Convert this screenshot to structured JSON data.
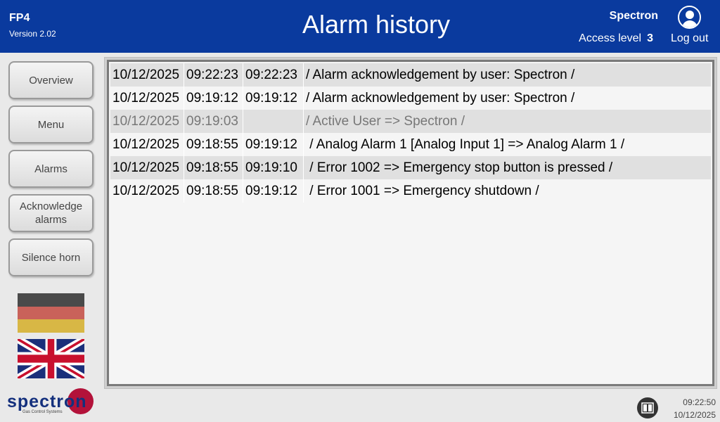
{
  "header": {
    "app_name": "FP4",
    "version": "Version 2.02",
    "title": "Alarm history",
    "user_name": "Spectron",
    "access_label": "Access level",
    "access_level": "3",
    "logout_label": "Log out"
  },
  "sidebar": {
    "overview": "Overview",
    "menu": "Menu",
    "alarms": "Alarms",
    "acknowledge": "Acknowledge alarms",
    "silence": "Silence horn"
  },
  "languages": [
    "German",
    "English"
  ],
  "logo": {
    "brand": "spectron",
    "tagline": "Gas Control Systems"
  },
  "alarm_history": [
    {
      "date": "10/12/2025",
      "time1": "09:22:23",
      "time2": "09:22:23",
      "message": "/ Alarm acknowledgement by user: Spectron /"
    },
    {
      "date": "10/12/2025",
      "time1": "09:19:12",
      "time2": "09:19:12",
      "message": "/ Alarm acknowledgement by user: Spectron /"
    },
    {
      "date": "10/12/2025",
      "time1": "09:19:03",
      "time2": "",
      "message": "/ Active User => Spectron /"
    },
    {
      "date": "10/12/2025",
      "time1": "09:18:55",
      "time2": "09:19:12",
      "message": " / Analog Alarm 1 [Analog Input 1] => Analog Alarm 1 /"
    },
    {
      "date": "10/12/2025",
      "time1": "09:18:55",
      "time2": "09:19:10",
      "message": " / Error 1002 => Emergency stop button is pressed /"
    },
    {
      "date": "10/12/2025",
      "time1": "09:18:55",
      "time2": "09:19:12",
      "message": " / Error 1001 => Emergency shutdown /"
    }
  ],
  "status": {
    "time": "09:22:50",
    "date": "10/12/2025"
  },
  "colors": {
    "header_bg": "#0a3a9e",
    "brand_blue": "#14307d",
    "brand_red": "#b3123a"
  }
}
